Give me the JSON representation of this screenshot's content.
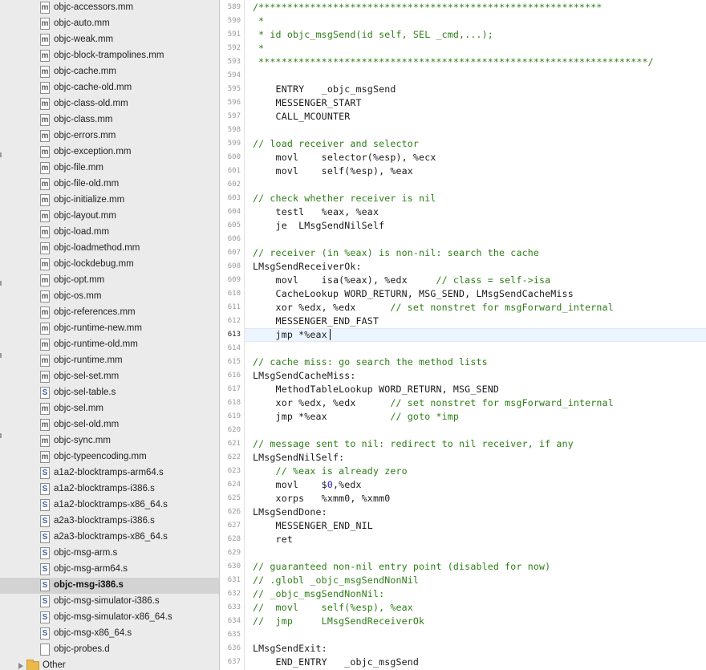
{
  "sidebar": {
    "files": [
      {
        "name": "objc-accessors.mm",
        "type": "m"
      },
      {
        "name": "objc-auto.mm",
        "type": "m"
      },
      {
        "name": "objc-weak.mm",
        "type": "m"
      },
      {
        "name": "objc-block-trampolines.mm",
        "type": "m"
      },
      {
        "name": "objc-cache.mm",
        "type": "m"
      },
      {
        "name": "objc-cache-old.mm",
        "type": "m"
      },
      {
        "name": "objc-class-old.mm",
        "type": "m"
      },
      {
        "name": "objc-class.mm",
        "type": "m"
      },
      {
        "name": "objc-errors.mm",
        "type": "m"
      },
      {
        "name": "objc-exception.mm",
        "type": "m"
      },
      {
        "name": "objc-file.mm",
        "type": "m"
      },
      {
        "name": "objc-file-old.mm",
        "type": "m"
      },
      {
        "name": "objc-initialize.mm",
        "type": "m"
      },
      {
        "name": "objc-layout.mm",
        "type": "m"
      },
      {
        "name": "objc-load.mm",
        "type": "m"
      },
      {
        "name": "objc-loadmethod.mm",
        "type": "m"
      },
      {
        "name": "objc-lockdebug.mm",
        "type": "m"
      },
      {
        "name": "objc-opt.mm",
        "type": "m"
      },
      {
        "name": "objc-os.mm",
        "type": "m"
      },
      {
        "name": "objc-references.mm",
        "type": "m"
      },
      {
        "name": "objc-runtime-new.mm",
        "type": "m"
      },
      {
        "name": "objc-runtime-old.mm",
        "type": "m"
      },
      {
        "name": "objc-runtime.mm",
        "type": "m"
      },
      {
        "name": "objc-sel-set.mm",
        "type": "m"
      },
      {
        "name": "objc-sel-table.s",
        "type": "s"
      },
      {
        "name": "objc-sel.mm",
        "type": "m"
      },
      {
        "name": "objc-sel-old.mm",
        "type": "m"
      },
      {
        "name": "objc-sync.mm",
        "type": "m"
      },
      {
        "name": "objc-typeencoding.mm",
        "type": "m"
      },
      {
        "name": "a1a2-blocktramps-arm64.s",
        "type": "s"
      },
      {
        "name": "a1a2-blocktramps-i386.s",
        "type": "s"
      },
      {
        "name": "a1a2-blocktramps-x86_64.s",
        "type": "s"
      },
      {
        "name": "a2a3-blocktramps-i386.s",
        "type": "s"
      },
      {
        "name": "a2a3-blocktramps-x86_64.s",
        "type": "s"
      },
      {
        "name": "objc-msg-arm.s",
        "type": "s"
      },
      {
        "name": "objc-msg-arm64.s",
        "type": "s"
      },
      {
        "name": "objc-msg-i386.s",
        "type": "s",
        "selected": true
      },
      {
        "name": "objc-msg-simulator-i386.s",
        "type": "s"
      },
      {
        "name": "objc-msg-simulator-x86_64.s",
        "type": "s"
      },
      {
        "name": "objc-msg-x86_64.s",
        "type": "s"
      },
      {
        "name": "objc-probes.d",
        "type": "d"
      }
    ],
    "folder": {
      "name": "Other"
    },
    "icons": {
      "m": "m-source-file-icon",
      "s": "s-assembly-file-icon",
      "d": "d-file-icon",
      "folder": "folder-icon"
    }
  },
  "editor": {
    "current_line": 613,
    "lines": [
      {
        "n": 589,
        "t": "/************************************************************",
        "c": true
      },
      {
        "n": 590,
        "t": " *",
        "c": true
      },
      {
        "n": 591,
        "t": " * id objc_msgSend(id self, SEL _cmd,...);",
        "c": true
      },
      {
        "n": 592,
        "t": " *",
        "c": true
      },
      {
        "n": 593,
        "t": " ********************************************************************/",
        "c": true
      },
      {
        "n": 594,
        "t": ""
      },
      {
        "n": 595,
        "t": "    ENTRY   _objc_msgSend"
      },
      {
        "n": 596,
        "t": "    MESSENGER_START"
      },
      {
        "n": 597,
        "t": "    CALL_MCOUNTER"
      },
      {
        "n": 598,
        "t": ""
      },
      {
        "n": 599,
        "t": "// load receiver and selector",
        "c": true
      },
      {
        "n": 600,
        "t": "    movl    selector(%esp), %ecx"
      },
      {
        "n": 601,
        "t": "    movl    self(%esp), %eax"
      },
      {
        "n": 602,
        "t": ""
      },
      {
        "n": 603,
        "t": "// check whether receiver is nil",
        "c": true
      },
      {
        "n": 604,
        "t": "    testl   %eax, %eax"
      },
      {
        "n": 605,
        "t": "    je  LMsgSendNilSelf"
      },
      {
        "n": 606,
        "t": ""
      },
      {
        "n": 607,
        "t": "// receiver (in %eax) is non-nil: search the cache",
        "c": true
      },
      {
        "n": 608,
        "t": "LMsgSendReceiverOk:"
      },
      {
        "n": 609,
        "t": "    movl    isa(%eax), %edx",
        "ct": "     // class = self->isa"
      },
      {
        "n": 610,
        "t": "    CacheLookup WORD_RETURN, MSG_SEND, LMsgSendCacheMiss"
      },
      {
        "n": 611,
        "t": "    xor %edx, %edx",
        "ct": "      // set nonstret for msgForward_internal"
      },
      {
        "n": 612,
        "t": "    MESSENGER_END_FAST"
      },
      {
        "n": 613,
        "t": "    jmp *%eax"
      },
      {
        "n": 614,
        "t": ""
      },
      {
        "n": 615,
        "t": "// cache miss: go search the method lists",
        "c": true
      },
      {
        "n": 616,
        "t": "LMsgSendCacheMiss:"
      },
      {
        "n": 617,
        "t": "    MethodTableLookup WORD_RETURN, MSG_SEND"
      },
      {
        "n": 618,
        "t": "    xor %edx, %edx",
        "ct": "      // set nonstret for msgForward_internal"
      },
      {
        "n": 619,
        "t": "    jmp *%eax",
        "ct": "           // goto *imp"
      },
      {
        "n": 620,
        "t": ""
      },
      {
        "n": 621,
        "t": "// message sent to nil: redirect to nil receiver, if any",
        "c": true
      },
      {
        "n": 622,
        "t": "LMsgSendNilSelf:"
      },
      {
        "n": 623,
        "t": "    // %eax is already zero",
        "c": true
      },
      {
        "n": 624,
        "t": "    movl    $",
        "num": "0",
        "rest": ",%edx"
      },
      {
        "n": 625,
        "t": "    xorps   %xmm0, %xmm0"
      },
      {
        "n": 626,
        "t": "LMsgSendDone:"
      },
      {
        "n": 627,
        "t": "    MESSENGER_END_NIL"
      },
      {
        "n": 628,
        "t": "    ret"
      },
      {
        "n": 629,
        "t": ""
      },
      {
        "n": 630,
        "t": "// guaranteed non-nil entry point (disabled for now)",
        "c": true
      },
      {
        "n": 631,
        "t": "// .globl _objc_msgSendNonNil",
        "c": true
      },
      {
        "n": 632,
        "t": "// _objc_msgSendNonNil:",
        "c": true
      },
      {
        "n": 633,
        "t": "//  movl    self(%esp), %eax",
        "c": true
      },
      {
        "n": 634,
        "t": "//  jmp     LMsgSendReceiverOk",
        "c": true
      },
      {
        "n": 635,
        "t": ""
      },
      {
        "n": 636,
        "t": "LMsgSendExit:"
      },
      {
        "n": 637,
        "t": "    END_ENTRY   _objc_msgSend"
      }
    ]
  }
}
